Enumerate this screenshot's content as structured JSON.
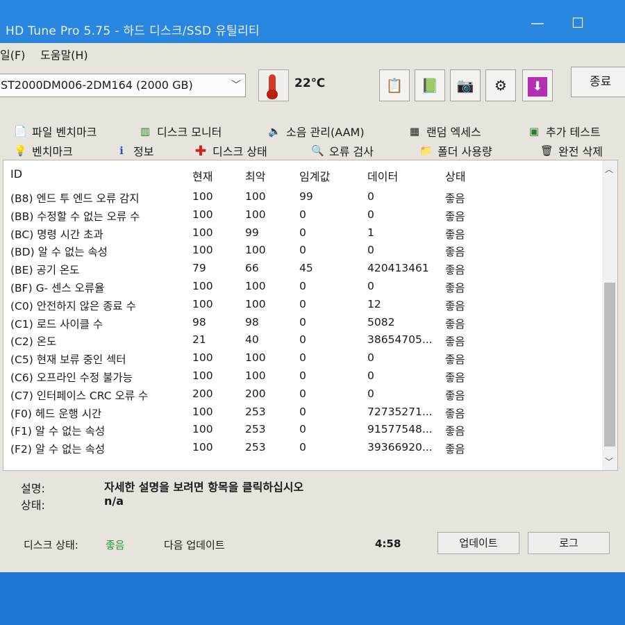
{
  "window": {
    "title": "HD Tune Pro 5.75 - 하드 디스크/SSD 유틸리티",
    "minimize": "—",
    "maximize": "☐"
  },
  "menu": {
    "file": "일(F)",
    "help": "도움말(H)"
  },
  "toolbar": {
    "drive": "ST2000DM006-2DM164 (2000 GB)",
    "temperature": "22℃",
    "exit_label": "종료",
    "icons": [
      "copy-info-icon",
      "copy-screen-icon",
      "camera-icon",
      "options-icon",
      "save-icon"
    ]
  },
  "tabs": {
    "row1": [
      "파일 벤치마크",
      "디스크 모니터",
      "소음 관리(AAM)",
      "랜덤 엑세스",
      "추가 테스트"
    ],
    "row2": [
      "벤치마크",
      "정보",
      "디스크 상태",
      "오류 검사",
      "폴더 사용량",
      "완전 삭제"
    ]
  },
  "table": {
    "columns": [
      "ID",
      "현재",
      "최악",
      "임계값",
      "데이터",
      "상태"
    ],
    "rows": [
      [
        "(B8) 엔드 투 엔드 오류 감지",
        "100",
        "100",
        "99",
        "0",
        "좋음"
      ],
      [
        "(BB) 수정할 수 없는 오류 수",
        "100",
        "100",
        "0",
        "0",
        "좋음"
      ],
      [
        "(BC) 명령 시간 초과",
        "100",
        "99",
        "0",
        "1",
        "좋음"
      ],
      [
        "(BD) 알 수 없는 속성",
        "100",
        "100",
        "0",
        "0",
        "좋음"
      ],
      [
        "(BE) 공기 온도",
        "79",
        "66",
        "45",
        "420413461",
        "좋음"
      ],
      [
        "(BF) G- 센스 오류율",
        "100",
        "100",
        "0",
        "0",
        "좋음"
      ],
      [
        "(C0) 안전하지 않은 종료 수",
        "100",
        "100",
        "0",
        "12",
        "좋음"
      ],
      [
        "(C1) 로드 사이클 수",
        "98",
        "98",
        "0",
        "5082",
        "좋음"
      ],
      [
        "(C2) 온도",
        "21",
        "40",
        "0",
        "38654705...",
        "좋음"
      ],
      [
        "(C5) 현재 보류 중인 섹터",
        "100",
        "100",
        "0",
        "0",
        "좋음"
      ],
      [
        "(C6) 오프라인 수정 불가능",
        "100",
        "100",
        "0",
        "0",
        "좋음"
      ],
      [
        "(C7) 인터페이스 CRC 오류 수",
        "200",
        "200",
        "0",
        "0",
        "좋음"
      ],
      [
        "(F0) 헤드 운행 시간",
        "100",
        "253",
        "0",
        "72735271...",
        "좋음"
      ],
      [
        "(F1) 알 수 없는 속성",
        "100",
        "253",
        "0",
        "91577548...",
        "좋음"
      ],
      [
        "(F2) 알 수 없는 속성",
        "100",
        "253",
        "0",
        "39366920...",
        "좋음"
      ]
    ]
  },
  "description": {
    "desc_label": "설명:",
    "desc_value": "자세한 설명을 보려면 항목을 클릭하십시오",
    "status_label": "상태:",
    "status_value": "n/a"
  },
  "statusbar": {
    "disk_status_label": "디스크 상태:",
    "disk_status_value": "좋음",
    "next_update_label": "다음 업데이트",
    "countdown": "4:58",
    "update_button": "업데이트",
    "log_button": "로그"
  },
  "colors": {
    "accent": "#2b86e0",
    "good_status": "#2e9a3a"
  }
}
